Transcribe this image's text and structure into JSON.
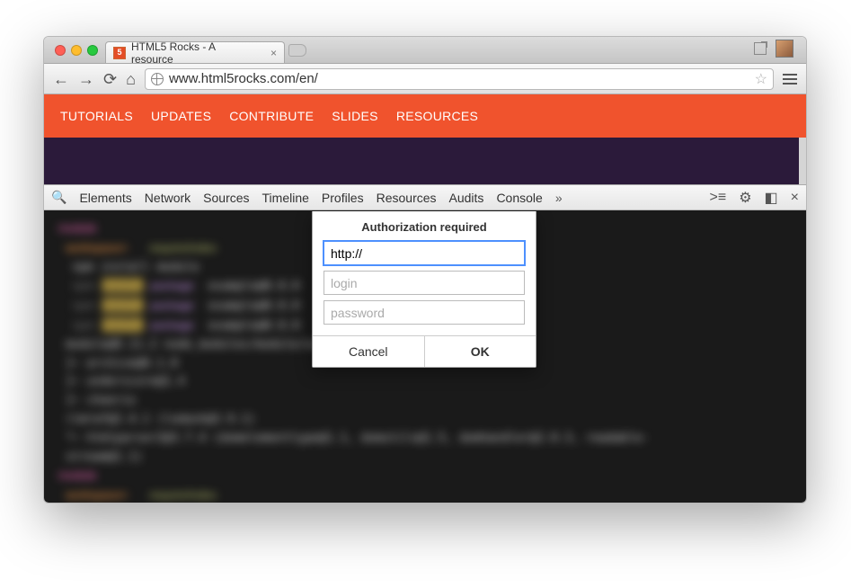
{
  "tab": {
    "title": "HTML5 Rocks - A resource"
  },
  "toolbar": {
    "url": "www.html5rocks.com/en/"
  },
  "site_nav": [
    "TUTORIALS",
    "UPDATES",
    "CONTRIBUTE",
    "SLIDES",
    "RESOURCES"
  ],
  "devtools": {
    "panels": [
      "Elements",
      "Network",
      "Sources",
      "Timeline",
      "Profiles",
      "Resources",
      "Audits",
      "Console"
    ]
  },
  "dialog": {
    "title": "Authorization required",
    "url_value": "http://",
    "login_placeholder": "login",
    "password_placeholder": "password",
    "cancel": "Cancel",
    "ok": "OK"
  }
}
